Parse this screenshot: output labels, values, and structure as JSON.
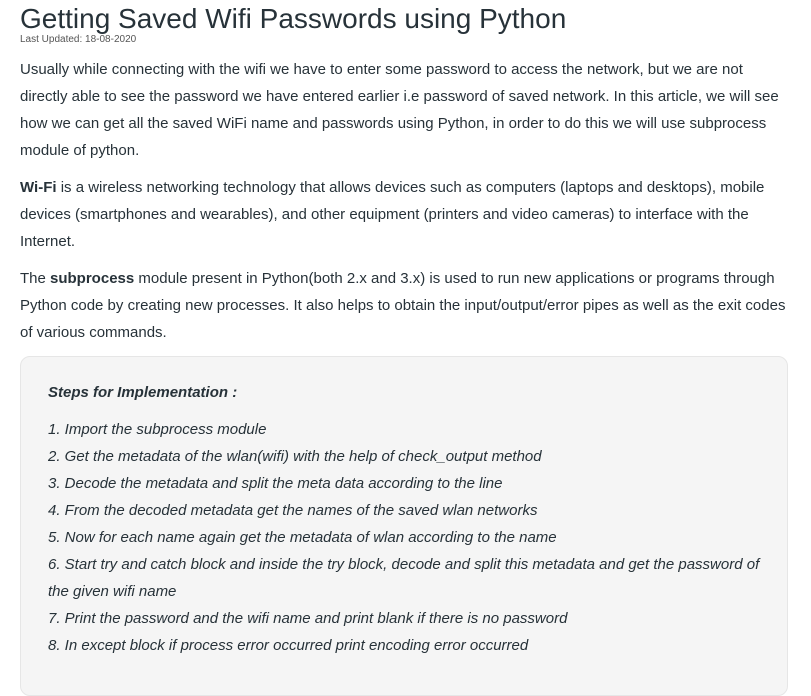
{
  "article": {
    "title": "Getting Saved Wifi Passwords using Python",
    "last_updated": "Last Updated: 18-08-2020",
    "intro": "Usually while connecting with the wifi we have to enter some password to access the network, but we are not directly able to see the password we have entered earlier i.e password of saved network. In this article, we will see how we can get all the saved WiFi name and passwords using Python, in order to do this we will use subprocess module of python.",
    "wifi_term": "Wi-Fi",
    "wifi_rest": " is a wireless networking technology that allows devices such as computers (laptops and desktops), mobile devices (smartphones and wearables), and other equipment (printers and video cameras) to interface with the Internet.",
    "sub_pre": "The ",
    "sub_term": "subprocess",
    "sub_rest": " module present in Python(both 2.x and 3.x) is used to run new applications or programs through Python code by creating new processes. It also helps to obtain the input/output/error pipes as well as the exit codes of various commands."
  },
  "steps": {
    "heading": "Steps for Implementation :",
    "items": [
      "1. Import the subprocess module",
      "2. Get the metadata of the wlan(wifi) with the help of check_output method",
      "3. Decode the metadata and split the meta data according to the line",
      "4. From the decoded metadata get the names of the saved wlan networks",
      "5. Now for each name again get the metadata of wlan according to the name",
      "6. Start try and catch block and inside the try block, decode and split this metadata and get the password of the given wifi name",
      "7. Print the password and the wifi name and print blank if there is no password",
      "8. In except block if process error occurred print encoding error occurred"
    ]
  }
}
